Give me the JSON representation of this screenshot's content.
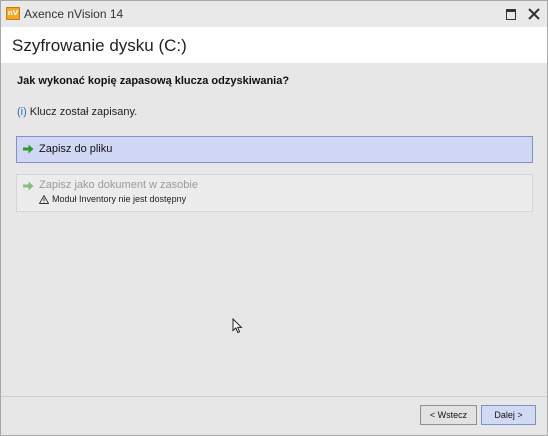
{
  "window": {
    "logo_text": "nV",
    "title": "Axence nVision 14"
  },
  "header": {
    "title": "Szyfrowanie dysku (C:)"
  },
  "main": {
    "question": "Jak wykonać kopię zapasową klucza odzyskiwania?",
    "info_mark": "(i)",
    "info_text": "Klucz został zapisany.",
    "options": [
      {
        "label": "Zapisz do pliku",
        "state": "selected"
      },
      {
        "label": "Zapisz jako dokument w zasobie",
        "state": "disabled",
        "warning": "Moduł Inventory nie jest dostępny"
      }
    ]
  },
  "footer": {
    "back_label": "< Wstecz",
    "next_label": "Dalej >"
  },
  "colors": {
    "selected_bg": "#cfd7f5",
    "selected_border": "#8091c9",
    "arrow_green": "#2e9b2e",
    "info_blue": "#2a6ebf"
  },
  "icons": [
    "app-logo-icon",
    "maximize-icon",
    "close-icon",
    "green-arrow-icon",
    "warning-icon",
    "mouse-cursor-icon"
  ]
}
